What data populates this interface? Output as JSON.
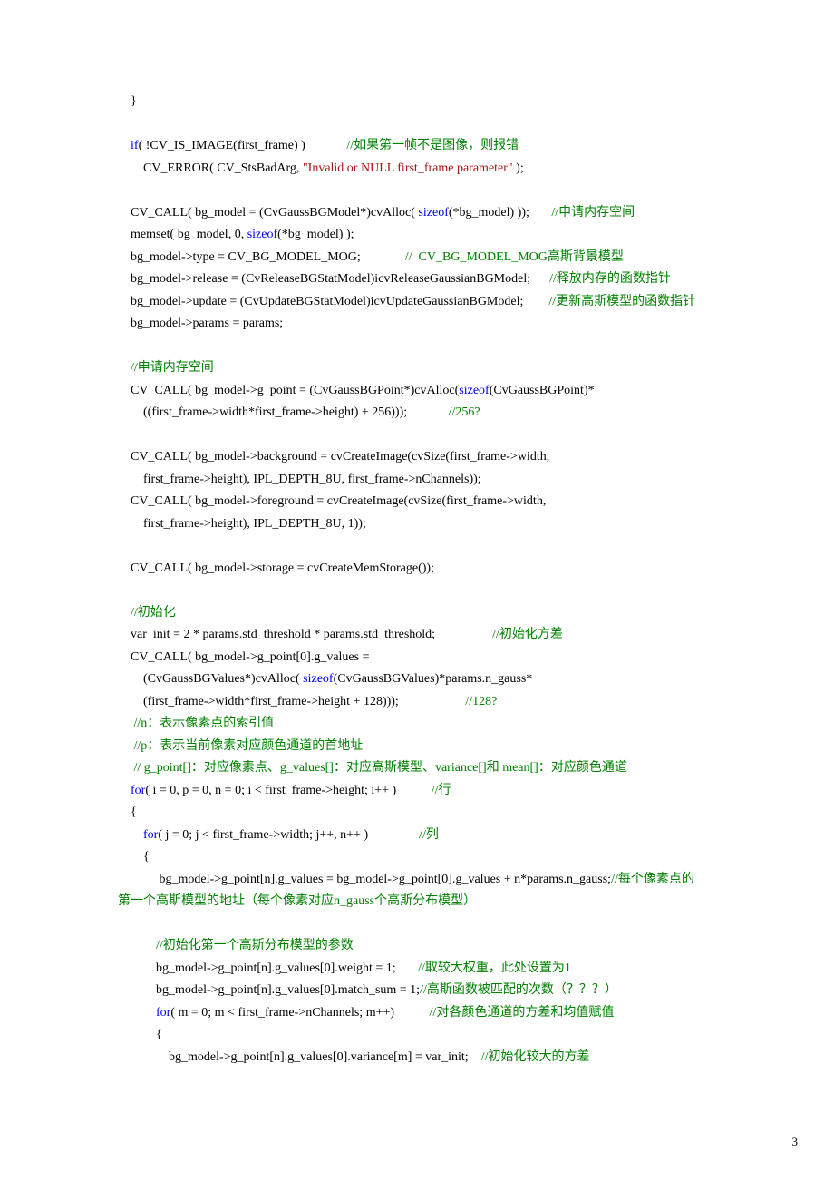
{
  "page_number": "3",
  "lines": [
    {
      "segs": [
        {
          "t": "    }",
          "c": ""
        }
      ]
    },
    {
      "segs": [
        {
          "t": "",
          "c": ""
        }
      ]
    },
    {
      "segs": [
        {
          "t": "    ",
          "c": ""
        },
        {
          "t": "if",
          "c": "kw"
        },
        {
          "t": "( !CV_IS_IMAGE(first_frame) )             ",
          "c": ""
        },
        {
          "t": "//如果第一帧不是图像，则报错",
          "c": "cmt"
        }
      ]
    },
    {
      "segs": [
        {
          "t": "        CV_ERROR( CV_StsBadArg, ",
          "c": ""
        },
        {
          "t": "\"Invalid or NULL first_frame parameter\"",
          "c": "str"
        },
        {
          "t": " );",
          "c": ""
        }
      ]
    },
    {
      "segs": [
        {
          "t": "",
          "c": ""
        }
      ]
    },
    {
      "segs": [
        {
          "t": "    CV_CALL( bg_model = (CvGaussBGModel*)cvAlloc( ",
          "c": ""
        },
        {
          "t": "sizeof",
          "c": "kw"
        },
        {
          "t": "(*bg_model) ));       ",
          "c": ""
        },
        {
          "t": "//申请内存空间",
          "c": "cmt"
        }
      ]
    },
    {
      "segs": [
        {
          "t": "    memset( bg_model, 0, ",
          "c": ""
        },
        {
          "t": "sizeof",
          "c": "kw"
        },
        {
          "t": "(*bg_model) );",
          "c": ""
        }
      ]
    },
    {
      "segs": [
        {
          "t": "    bg_model->type = CV_BG_MODEL_MOG;              ",
          "c": ""
        },
        {
          "t": "//  CV_BG_MODEL_MOG高斯背景模型",
          "c": "cmt"
        }
      ]
    },
    {
      "segs": [
        {
          "t": "    bg_model->release = (CvReleaseBGStatModel)icvReleaseGaussianBGModel;      ",
          "c": ""
        },
        {
          "t": "//释放内存的函数指针",
          "c": "cmt"
        }
      ]
    },
    {
      "segs": [
        {
          "t": "    bg_model->update = (CvUpdateBGStatModel)icvUpdateGaussianBGModel;        ",
          "c": ""
        },
        {
          "t": "//更新高斯模型的函数指针",
          "c": "cmt"
        }
      ]
    },
    {
      "segs": [
        {
          "t": "    bg_model->params = params;",
          "c": ""
        }
      ]
    },
    {
      "segs": [
        {
          "t": "",
          "c": ""
        }
      ]
    },
    {
      "segs": [
        {
          "t": "    ",
          "c": ""
        },
        {
          "t": "//申请内存空间",
          "c": "cmt"
        }
      ]
    },
    {
      "segs": [
        {
          "t": "    CV_CALL( bg_model->g_point = (CvGaussBGPoint*)cvAlloc(",
          "c": ""
        },
        {
          "t": "sizeof",
          "c": "kw"
        },
        {
          "t": "(CvGaussBGPoint)*",
          "c": ""
        }
      ]
    },
    {
      "segs": [
        {
          "t": "        ((first_frame->width*first_frame->height) + 256)));             ",
          "c": ""
        },
        {
          "t": "//256?",
          "c": "cmt"
        }
      ]
    },
    {
      "segs": [
        {
          "t": "",
          "c": ""
        }
      ]
    },
    {
      "segs": [
        {
          "t": "    CV_CALL( bg_model->background = cvCreateImage(cvSize(first_frame->width,",
          "c": ""
        }
      ]
    },
    {
      "segs": [
        {
          "t": "        first_frame->height), IPL_DEPTH_8U, first_frame->nChannels));",
          "c": ""
        }
      ]
    },
    {
      "segs": [
        {
          "t": "    CV_CALL( bg_model->foreground = cvCreateImage(cvSize(first_frame->width,",
          "c": ""
        }
      ]
    },
    {
      "segs": [
        {
          "t": "        first_frame->height), IPL_DEPTH_8U, 1));",
          "c": ""
        }
      ]
    },
    {
      "segs": [
        {
          "t": "",
          "c": ""
        }
      ]
    },
    {
      "segs": [
        {
          "t": "    CV_CALL( bg_model->storage = cvCreateMemStorage());",
          "c": ""
        }
      ]
    },
    {
      "segs": [
        {
          "t": "",
          "c": ""
        }
      ]
    },
    {
      "segs": [
        {
          "t": "    ",
          "c": ""
        },
        {
          "t": "//初始化",
          "c": "cmt"
        }
      ]
    },
    {
      "segs": [
        {
          "t": "    var_init = 2 * params.std_threshold * params.std_threshold;                  ",
          "c": ""
        },
        {
          "t": "//初始化方差",
          "c": "cmt"
        }
      ]
    },
    {
      "segs": [
        {
          "t": "    CV_CALL( bg_model->g_point[0].g_values =",
          "c": ""
        }
      ]
    },
    {
      "segs": [
        {
          "t": "        (CvGaussBGValues*)cvAlloc( ",
          "c": ""
        },
        {
          "t": "sizeof",
          "c": "kw"
        },
        {
          "t": "(CvGaussBGValues)*params.n_gauss*",
          "c": ""
        }
      ]
    },
    {
      "segs": [
        {
          "t": "        (first_frame->width*first_frame->height + 128)));                     ",
          "c": ""
        },
        {
          "t": "//128?",
          "c": "cmt"
        }
      ]
    },
    {
      "segs": [
        {
          "t": "     ",
          "c": ""
        },
        {
          "t": "//n：表示像素点的索引值",
          "c": "cmt"
        }
      ]
    },
    {
      "segs": [
        {
          "t": "     ",
          "c": ""
        },
        {
          "t": "//p：表示当前像素对应颜色通道的首地址",
          "c": "cmt"
        }
      ]
    },
    {
      "segs": [
        {
          "t": "     ",
          "c": ""
        },
        {
          "t": "// g_point[]：对应像素点、g_values[]：对应高斯模型、variance[]和 mean[]：对应颜色通道",
          "c": "cmt"
        }
      ]
    },
    {
      "segs": [
        {
          "t": "    ",
          "c": ""
        },
        {
          "t": "for",
          "c": "kw"
        },
        {
          "t": "( i = 0, p = 0, n = 0; i < first_frame->height; i++ )           ",
          "c": ""
        },
        {
          "t": "//行",
          "c": "cmt"
        }
      ]
    },
    {
      "segs": [
        {
          "t": "    {",
          "c": ""
        }
      ]
    },
    {
      "segs": [
        {
          "t": "        ",
          "c": ""
        },
        {
          "t": "for",
          "c": "kw"
        },
        {
          "t": "( j = 0; j < first_frame->width; j++, n++ )                ",
          "c": ""
        },
        {
          "t": "//列",
          "c": "cmt"
        }
      ]
    },
    {
      "segs": [
        {
          "t": "        {",
          "c": ""
        }
      ]
    },
    {
      "segs": [
        {
          "t": "             bg_model->g_point[n].g_values = bg_model->g_point[0].g_values + n*params.n_gauss;",
          "c": ""
        },
        {
          "t": "//每个像素点的",
          "c": "cmt"
        }
      ]
    },
    {
      "segs": [
        {
          "t": "第一个高斯模型的地址（每个像素对应n_gauss个高斯分布模型）",
          "c": "cmt"
        }
      ]
    },
    {
      "segs": [
        {
          "t": "",
          "c": ""
        }
      ]
    },
    {
      "segs": [
        {
          "t": "            ",
          "c": ""
        },
        {
          "t": "//初始化第一个高斯分布模型的参数",
          "c": "cmt"
        }
      ]
    },
    {
      "segs": [
        {
          "t": "            bg_model->g_point[n].g_values[0].weight = 1;       ",
          "c": ""
        },
        {
          "t": "//取较大权重，此处设置为1",
          "c": "cmt"
        }
      ]
    },
    {
      "segs": [
        {
          "t": "            bg_model->g_point[n].g_values[0].match_sum = 1;",
          "c": ""
        },
        {
          "t": "//高斯函数被匹配的次数（？？？）",
          "c": "cmt"
        }
      ]
    },
    {
      "segs": [
        {
          "t": "            ",
          "c": ""
        },
        {
          "t": "for",
          "c": "kw"
        },
        {
          "t": "( m = 0; m < first_frame->nChannels; m++)           ",
          "c": ""
        },
        {
          "t": "//对各颜色通道的方差和均值赋值",
          "c": "cmt"
        }
      ]
    },
    {
      "segs": [
        {
          "t": "            {",
          "c": ""
        }
      ]
    },
    {
      "segs": [
        {
          "t": "                bg_model->g_point[n].g_values[0].variance[m] = var_init;    ",
          "c": ""
        },
        {
          "t": "//初始化较大的方差",
          "c": "cmt"
        }
      ]
    }
  ]
}
